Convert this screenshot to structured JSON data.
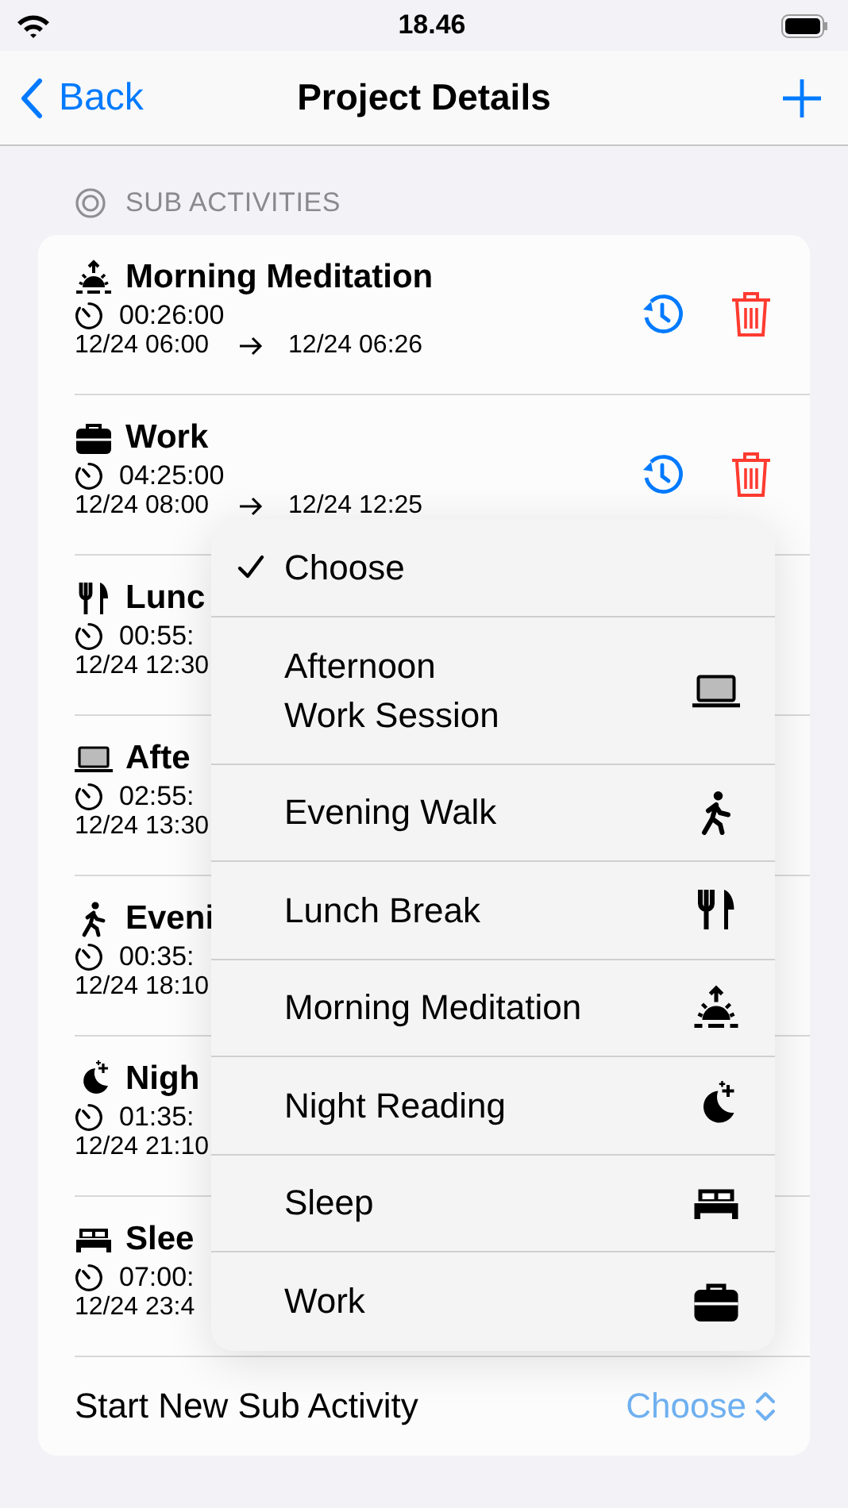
{
  "status_bar": {
    "time": "18.46"
  },
  "nav": {
    "back": "Back",
    "title": "Project Details"
  },
  "section": {
    "title": "SUB ACTIVITIES"
  },
  "activities": [
    {
      "kind": "meditation",
      "title": "Morning Meditation",
      "duration": "00:26:00",
      "start": "12/24 06:00",
      "end": "12/24 06:26",
      "actions": true
    },
    {
      "kind": "work",
      "title": "Work",
      "duration": "04:25:00",
      "start": "12/24 08:00",
      "end": "12/24 12:25",
      "actions": true
    },
    {
      "kind": "meal",
      "title": "Lunc",
      "duration": "00:55:",
      "start": "12/24 12:30",
      "actions": false
    },
    {
      "kind": "session",
      "title": "Afte",
      "duration": "02:55:",
      "start": "12/24 13:30",
      "actions": false
    },
    {
      "kind": "walk",
      "title": "Eveni",
      "duration": "00:35:",
      "start": "12/24 18:10",
      "actions": false
    },
    {
      "kind": "reading",
      "title": "Nigh",
      "duration": "01:35:",
      "start": "12/24 21:10",
      "actions": false
    },
    {
      "kind": "sleep",
      "title": "Slee",
      "duration": "07:00:",
      "start": "12/24 23:4",
      "actions": false
    }
  ],
  "new_activity": {
    "label": "Start New Sub Activity",
    "value": "Choose"
  },
  "menu": {
    "items": [
      {
        "label": "Choose",
        "selected": true
      },
      {
        "label": "Afternoon\nWork Session",
        "kind": "session",
        "selected": false
      },
      {
        "label": "Evening Walk",
        "kind": "walk",
        "selected": false
      },
      {
        "label": "Lunch Break",
        "kind": "meal",
        "selected": false
      },
      {
        "label": "Morning Meditation",
        "kind": "meditation",
        "selected": false
      },
      {
        "label": "Night Reading",
        "kind": "reading",
        "selected": false
      },
      {
        "label": "Sleep",
        "kind": "sleep",
        "selected": false
      },
      {
        "label": "Work",
        "kind": "work",
        "selected": false
      }
    ]
  }
}
